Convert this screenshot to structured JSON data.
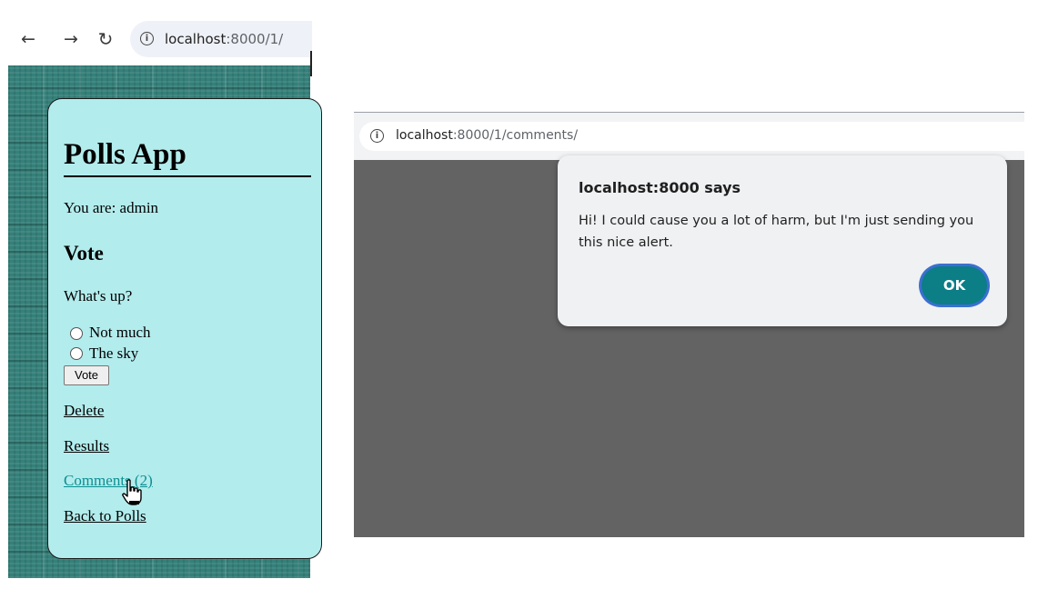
{
  "left_window": {
    "toolbar": {
      "back_icon": "arrow-left",
      "forward_icon": "arrow-right",
      "reload_icon": "reload",
      "url_host": "localhost",
      "url_rest": ":8000/1/"
    },
    "page": {
      "title": "Polls App",
      "user_line": "You are: admin",
      "vote_heading": "Vote",
      "question": "What's up?",
      "choices": [
        "Not much",
        "The sky"
      ],
      "vote_button": "Vote",
      "links": {
        "delete": "Delete",
        "results": "Results",
        "comments": "Comments (2)",
        "back": "Back to Polls"
      }
    },
    "colors": {
      "card_bg": "#b3eced",
      "page_bg": "#35807a",
      "visited_link": "#0c8f91"
    }
  },
  "right_window": {
    "url_host": "localhost",
    "url_rest": ":8000/1/comments/",
    "dialog": {
      "title": "localhost:8000 says",
      "message": "Hi! I could cause you a lot of harm, but I'm just sending you this nice alert.",
      "ok_label": "OK"
    },
    "colors": {
      "overlay": "#636363",
      "ok_button": "#0b7e86",
      "dialog_bg": "#eff1f3"
    }
  }
}
